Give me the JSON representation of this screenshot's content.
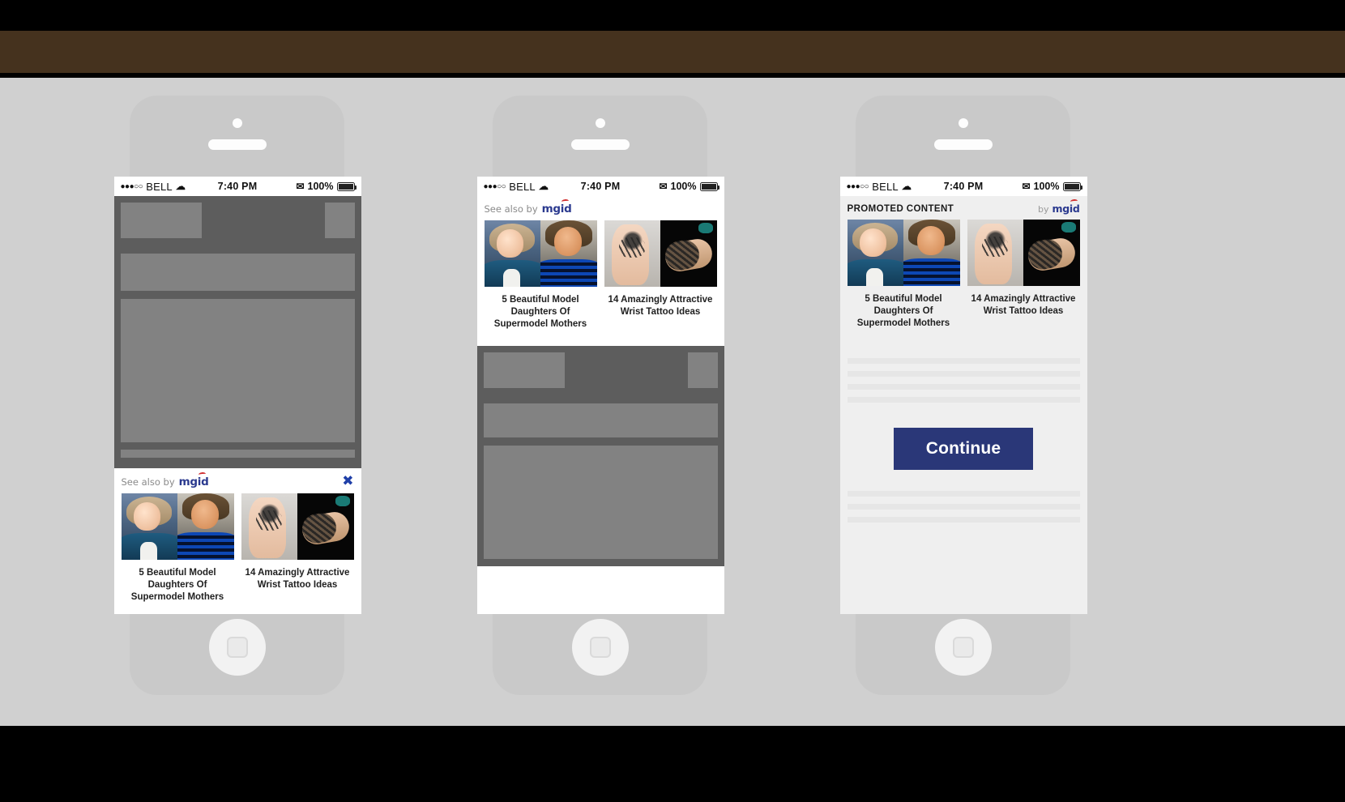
{
  "theme": {
    "banner_color": "#45321e",
    "stage_color": "#d0d0d0",
    "phone_body_color": "#c9c9c9",
    "accent_blue": "#2b3a8f",
    "continue_color": "#2a3778",
    "close_color": "#1f3fa8",
    "mgid_red": "#d03030"
  },
  "status_bar": {
    "signal_dots": "●●●○○",
    "carrier": "BELL",
    "wifi_icon": "wifi-icon",
    "time": "7:40 PM",
    "bluetooth_icon": "bluetooth-icon",
    "battery_percent": "100%",
    "battery_icon": "battery-full-icon"
  },
  "widget": {
    "see_also_label": "See also by",
    "promoted_label": "PROMOTED CONTENT",
    "by_label": "by",
    "brand": "mgid",
    "close_icon": "✖",
    "cards": [
      {
        "title": "5 Beautiful Model Daughters Of Supermodel Mothers",
        "image_name": "models-photo"
      },
      {
        "title": "14 Amazingly Attractive Wrist Tattoo Ideas",
        "image_name": "wrist-tattoo-photo"
      }
    ]
  },
  "phones": [
    {
      "id": "phone-1",
      "variant": "bottom-docked-widget",
      "has_close_button": true,
      "header_style": "see-also"
    },
    {
      "id": "phone-2",
      "variant": "top-docked-widget",
      "has_close_button": false,
      "header_style": "see-also"
    },
    {
      "id": "phone-3",
      "variant": "interstitial-widget",
      "has_close_button": false,
      "header_style": "promoted"
    }
  ],
  "phone3": {
    "continue_label": "Continue"
  }
}
